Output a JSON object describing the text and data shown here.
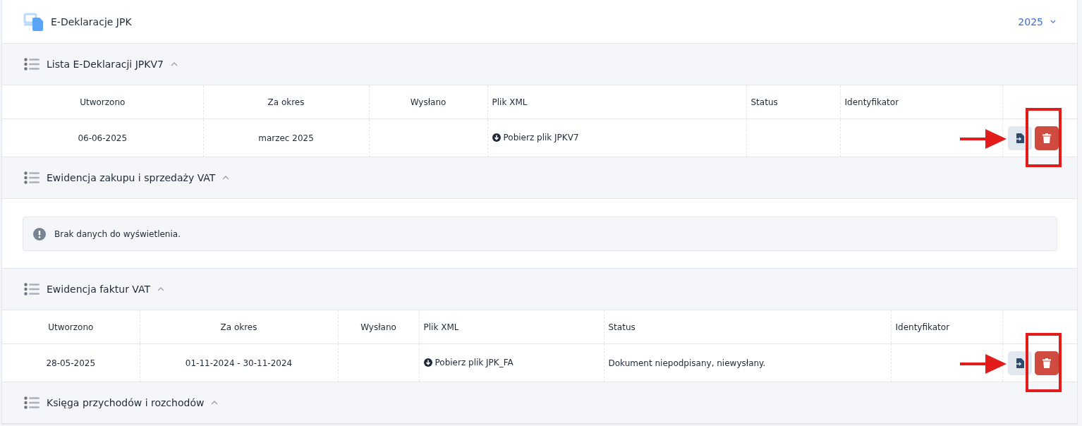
{
  "header": {
    "title": "E-Deklaracje JPK",
    "year": "2025"
  },
  "sections": [
    {
      "title": "Lista E-Deklaracji JPKV7",
      "expanded": true,
      "kind": "table",
      "columns": [
        "Utworzono",
        "Za okres",
        "Wysłano",
        "Plik XML",
        "Status",
        "Identyfikator"
      ],
      "rows": [
        {
          "created": "06-06-2025",
          "period": "marzec 2025",
          "sent": "",
          "download": "Pobierz plik JPKV7",
          "status": "",
          "identifier": "",
          "highlighted": true
        }
      ]
    },
    {
      "title": "Ewidencja zakupu i sprzedaży VAT",
      "expanded": true,
      "kind": "empty",
      "message": "Brak danych do wyświetlenia."
    },
    {
      "title": "Ewidencja faktur VAT",
      "expanded": true,
      "kind": "table",
      "columns": [
        "Utworzono",
        "Za okres",
        "Wysłano",
        "Plik XML",
        "Status",
        "Identyfikator"
      ],
      "rows": [
        {
          "created": "28-05-2025",
          "period": "01-11-2024 - 30-11-2024",
          "sent": "",
          "download": "Pobierz plik JPK_FA",
          "status": "Dokument niepodpisany, niewysłany.",
          "identifier": "",
          "highlighted": true
        }
      ]
    },
    {
      "title": "Księga przychodów i rozchodów",
      "expanded": true,
      "kind": "collapsed-bottom"
    }
  ]
}
